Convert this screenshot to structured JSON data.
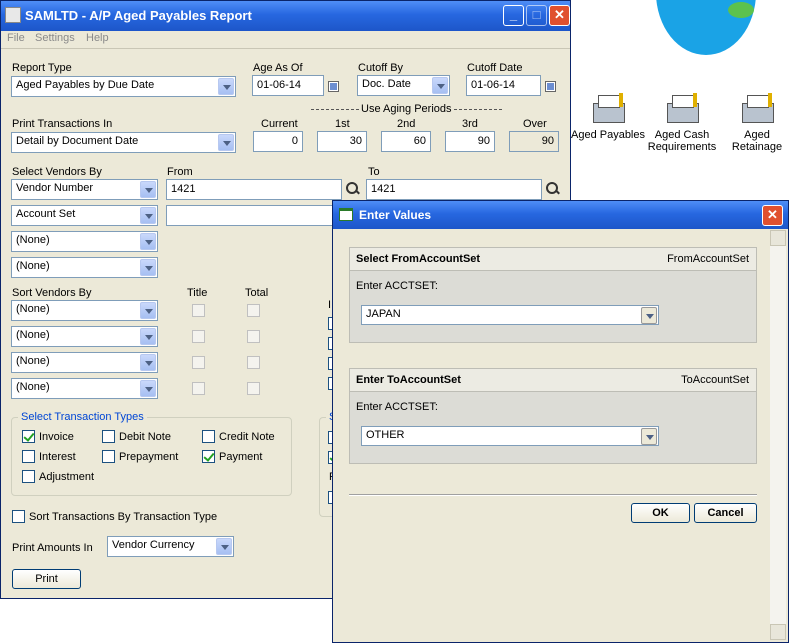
{
  "window": {
    "title": "SAMLTD - A/P Aged Payables Report",
    "menu": [
      "File",
      "Settings",
      "Help"
    ]
  },
  "report": {
    "report_type_label": "Report Type",
    "report_type_value": "Aged Payables by Due Date",
    "age_as_of_label": "Age As Of",
    "age_as_of_value": "01-06-14",
    "cutoff_by_label": "Cutoff By",
    "cutoff_by_value": "Doc. Date",
    "cutoff_date_label": "Cutoff Date",
    "cutoff_date_value": "01-06-14",
    "aging_periods_label": "Use Aging Periods",
    "print_trans_label": "Print Transactions In",
    "print_trans_value": "Detail by Document Date",
    "periods": [
      {
        "label": "Current",
        "value": "0"
      },
      {
        "label": "1st",
        "value": "30"
      },
      {
        "label": "2nd",
        "value": "60"
      },
      {
        "label": "3rd",
        "value": "90"
      },
      {
        "label": "Over",
        "value": "90"
      }
    ],
    "select_vendors_label": "Select Vendors By",
    "from_label": "From",
    "to_label": "To",
    "select_rows": [
      {
        "value": "Vendor Number",
        "from": "1421",
        "to": "1421"
      },
      {
        "value": "Account Set",
        "from": "",
        "to": ""
      },
      {
        "value": "(None)"
      },
      {
        "value": "(None)"
      }
    ],
    "sort_vendors_label": "Sort Vendors By",
    "title_label": "Title",
    "total_label": "Total",
    "sort_rows": [
      "(None)",
      "(None)",
      "(None)",
      "(None)"
    ],
    "trans_types_title": "Select Transaction Types",
    "trans_types": [
      {
        "label": "Invoice",
        "checked": true
      },
      {
        "label": "Debit Note",
        "checked": false
      },
      {
        "label": "Credit Note",
        "checked": false
      },
      {
        "label": "Interest",
        "checked": false
      },
      {
        "label": "Prepayment",
        "checked": false
      },
      {
        "label": "Payment",
        "checked": true
      },
      {
        "label": "Adjustment",
        "checked": false
      }
    ],
    "sort_by_type_label": "Sort Transactions By Transaction Type",
    "print_amounts_label": "Print Amounts In",
    "print_amounts_value": "Vendor Currency",
    "print_button": "Print",
    "hidden_panel_letters": [
      "I",
      "S",
      "F"
    ]
  },
  "desktop_icons": [
    {
      "label": "Aged Payables",
      "icon": "report-printer-icon"
    },
    {
      "label": "Aged Cash Requirements",
      "icon": "report-printer-icon"
    },
    {
      "label": "Aged Retainage",
      "icon": "report-printer-icon"
    }
  ],
  "dialog": {
    "title": "Enter Values",
    "sections": [
      {
        "header": "Select FromAccountSet",
        "param": "FromAccountSet",
        "prompt": "Enter ACCTSET:",
        "value": "JAPAN"
      },
      {
        "header": "Enter ToAccountSet",
        "param": "ToAccountSet",
        "prompt": "Enter ACCTSET:",
        "value": "OTHER"
      }
    ],
    "ok_button": "OK",
    "cancel_button": "Cancel"
  },
  "colors": {
    "titlebar": "#2767e0",
    "group_title": "#0046d5",
    "window_bg": "#ece9d8"
  }
}
